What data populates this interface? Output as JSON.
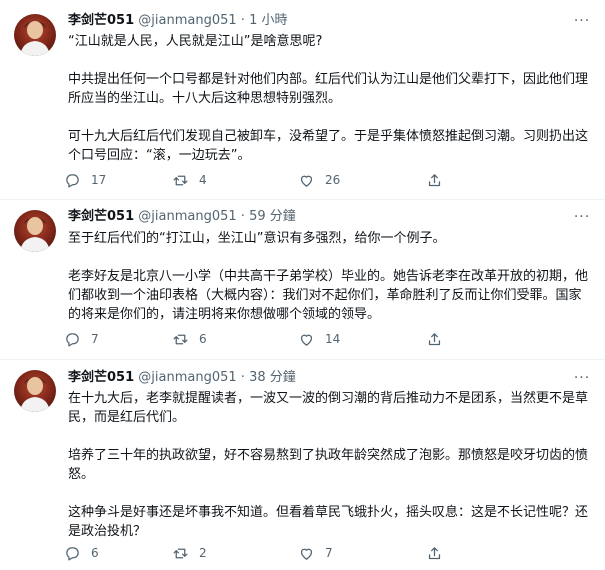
{
  "tweets": [
    {
      "name": "李剑芒051",
      "handle": "@jianmang051",
      "time": "1 小時",
      "paragraphs": [
        "“江山就是人民，人民就是江山”是啥意思呢?",
        "中共提出任何一个口号都是针对他们内部。红后代们认为江山是他们父辈打下，因此他们理所应当的坐江山。十八大后这种思想特别强烈。",
        "可十九大后红后代们发现自己被卸车，没希望了。于是乎集体愤怒推起倒习潮。习则扔出这个口号回应：“滚，一边玩去”。"
      ],
      "reply_count": "17",
      "retweet_count": "4",
      "like_count": "26"
    },
    {
      "name": "李剑芒051",
      "handle": "@jianmang051",
      "time": "59 分鐘",
      "paragraphs": [
        "至于红后代们的“打江山，坐江山”意识有多强烈，给你一个例子。",
        "老李好友是北京八一小学（中共高干子弟学校）毕业的。她告诉老李在改革开放的初期，他们都收到一个油印表格（大概内容）：我们对不起你们，革命胜利了反而让你们受罪。国家的将来是你们的，请注明将来你想做哪个领域的领导。"
      ],
      "reply_count": "7",
      "retweet_count": "6",
      "like_count": "14"
    },
    {
      "name": "李剑芒051",
      "handle": "@jianmang051",
      "time": "38 分鐘",
      "paragraphs": [
        "在十九大后，老李就提醒读者，一波又一波的倒习潮的背后推动力不是团系，当然更不是草民，而是红后代们。",
        "培养了三十年的执政欲望，好不容易熬到了执政年龄突然成了泡影。那愤怒是咬牙切齿的愤怒。",
        "这种争斗是好事还是坏事我不知道。但看着草民飞蛾扑火，摇头叹息：这是不长记性呢？还是政治投机？"
      ],
      "reply_count": "6",
      "retweet_count": "2",
      "like_count": "7"
    }
  ],
  "separator": "·",
  "more_glyph": "···",
  "icons": [
    "reply-icon",
    "retweet-icon",
    "like-icon",
    "share-icon",
    "more-icon"
  ],
  "colors": {
    "text": "#0f1419",
    "muted": "#536471",
    "divider": "#eff3f4"
  }
}
